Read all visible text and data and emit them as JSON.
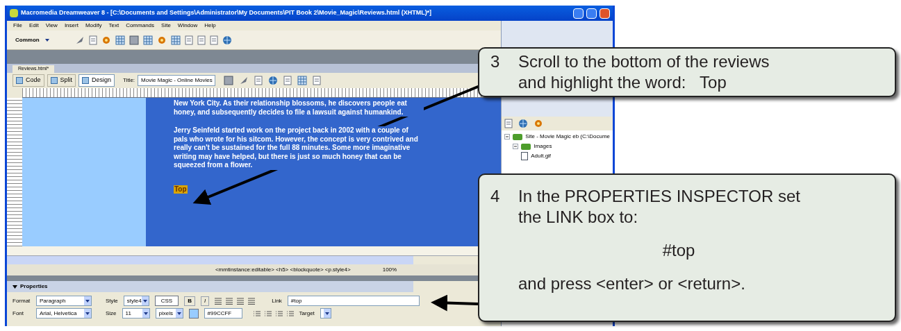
{
  "window": {
    "title": "Macromedia Dreamweaver 8 - [C:\\Documents and Settings\\Administrator\\My Documents\\PIT Book 2\\Movie_Magic\\Reviews.html (XHTML)*]"
  },
  "menu": [
    "File",
    "Edit",
    "View",
    "Insert",
    "Modify",
    "Text",
    "Commands",
    "Site",
    "Window",
    "Help"
  ],
  "insert_bar": {
    "category": "Common"
  },
  "document_tab": {
    "label": "Reviews.html*"
  },
  "view_buttons": [
    {
      "label": "Code",
      "selected": false
    },
    {
      "label": "Split",
      "selected": false
    },
    {
      "label": "Design",
      "selected": true
    }
  ],
  "title_field": {
    "label": "Title:",
    "value": "Movie Magic - Online Movies"
  },
  "design_view": {
    "paragraphs": [
      "New York City. As their relationship blossoms, he discovers people eat honey, and subsequently decides to file a lawsuit against humankind.",
      "Jerry Seinfeld started work on the project back in 2002 with a couple of pals who wrote for his sitcom. However, the concept is very contrived and really can't be sustained for the full 88 minutes.  Some more imaginative writing may have helped, but there is just so much honey that can be squeezed from a flower."
    ],
    "top_link": {
      "label": "Top",
      "selected": true
    }
  },
  "tag_selector": "<mmtinstance:editable> <h5> <blockquote> <p.style4>",
  "zoom": "100%",
  "files_panel": {
    "tree": [
      {
        "label": "Site - Movie Magic eb (C:\\Docume",
        "expanded": true,
        "children": [
          {
            "label": "Images",
            "expanded": true,
            "children": [
              {
                "label": "Adult.gif"
              }
            ]
          }
        ]
      }
    ]
  },
  "properties": {
    "title": "Properties",
    "expanded": true,
    "format": {
      "label": "Format",
      "value": "Paragraph"
    },
    "style": {
      "label": "Style",
      "value": "style4"
    },
    "css_button": "CSS",
    "text_buttons": [
      "B",
      "I"
    ],
    "link": {
      "label": "Link",
      "value": "#top"
    },
    "font": {
      "label": "Font",
      "value": "Arial, Helvetica"
    },
    "size": {
      "label": "Size",
      "value": "11",
      "unit": "pixels"
    },
    "color": {
      "value": "#99CCFF"
    },
    "target": {
      "label": "Target"
    }
  },
  "callouts": [
    {
      "number": "3",
      "lines": [
        "Scroll to the bottom of the reviews",
        "and highlight the word:   Top"
      ]
    },
    {
      "number": "4",
      "lines": [
        "In the PROPERTIES INSPECTOR set",
        "the LINK box to:"
      ],
      "value": "#top",
      "after": "and press <enter> or <return>."
    }
  ]
}
